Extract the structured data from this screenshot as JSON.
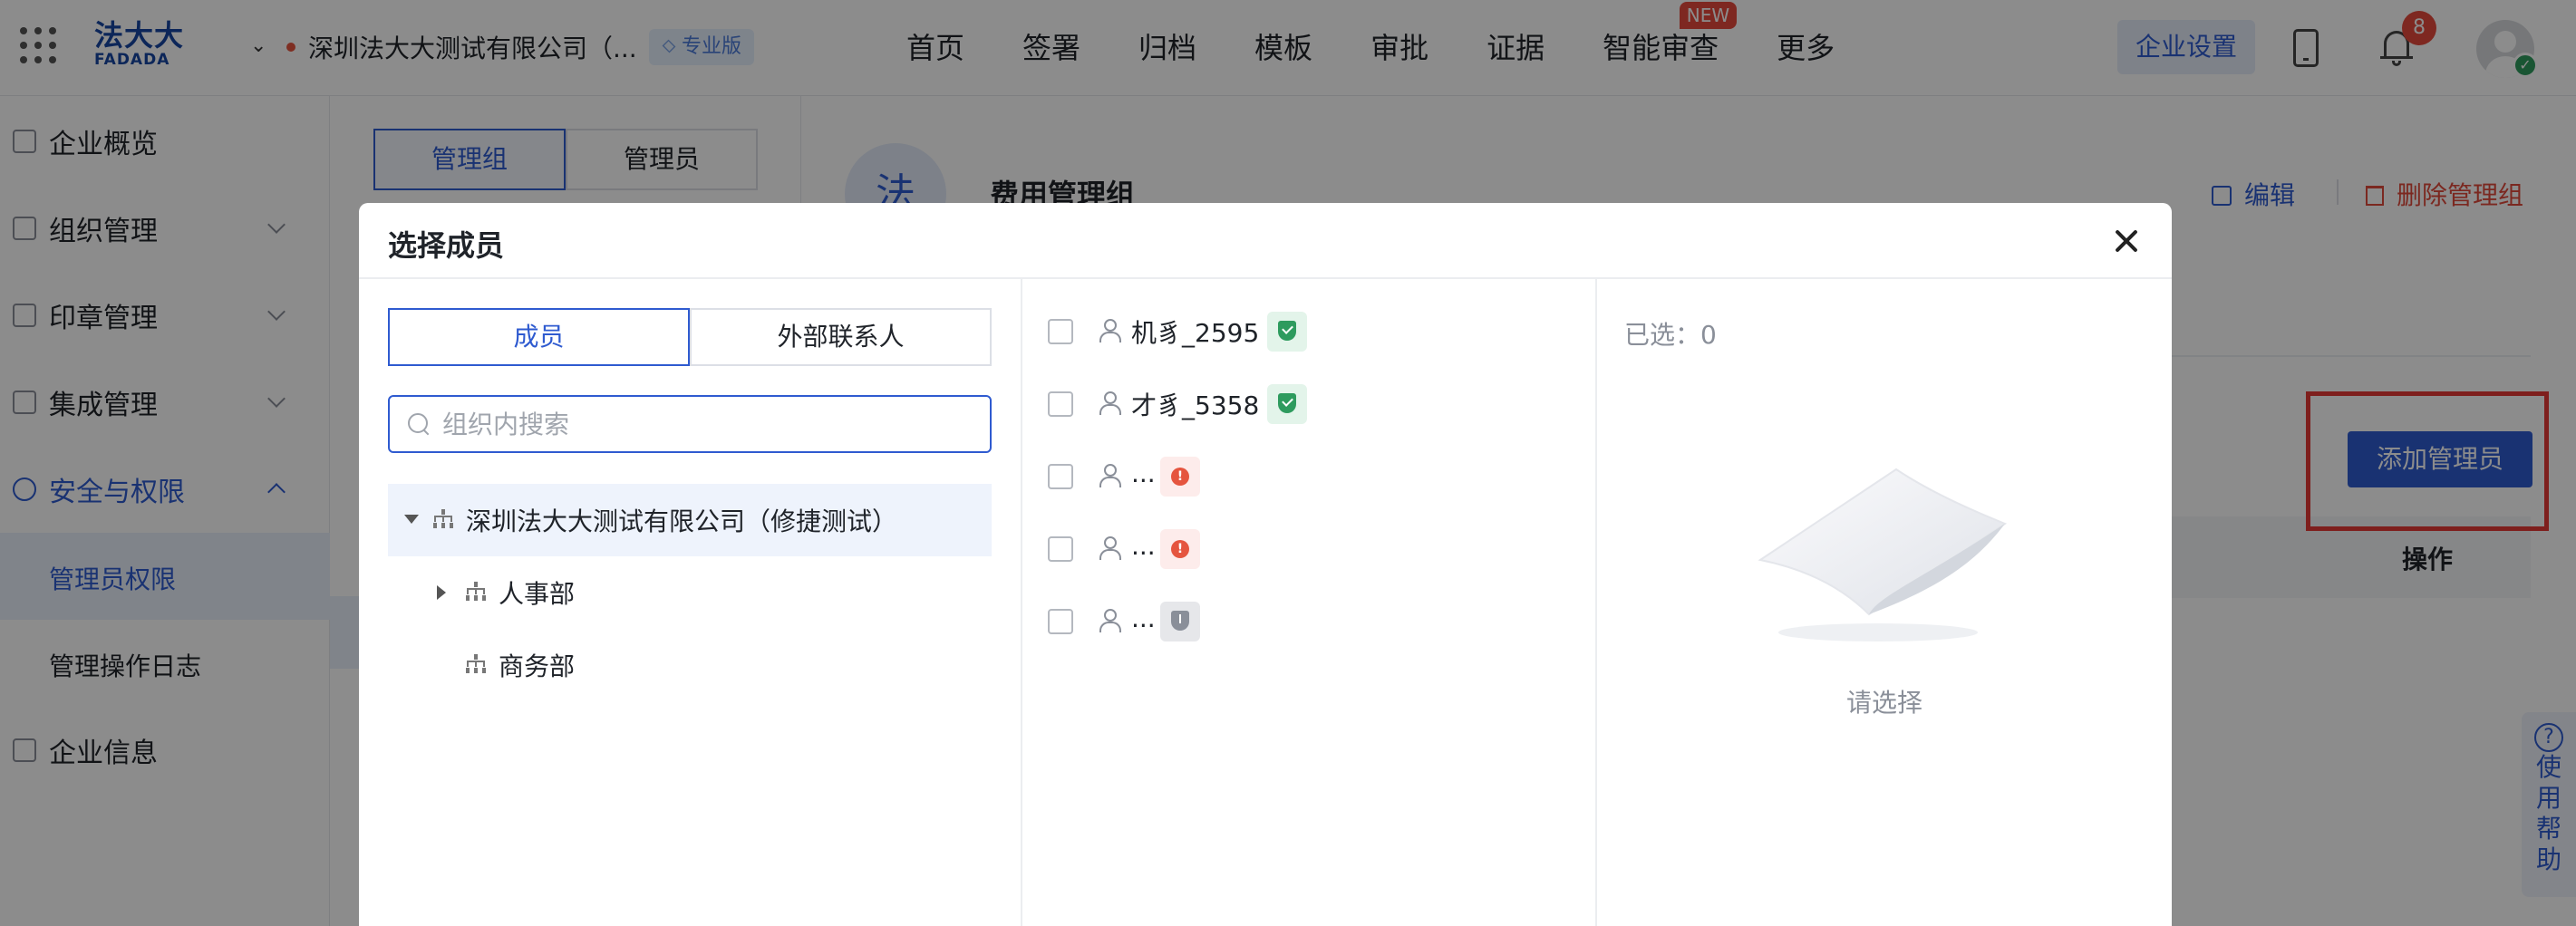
{
  "topbar": {
    "logo_line1": "法大大",
    "logo_line2": "FADADA",
    "company_name": "深圳法大大测试有限公司（...",
    "edition": "专业版",
    "nav": [
      {
        "label": "首页"
      },
      {
        "label": "签署"
      },
      {
        "label": "归档"
      },
      {
        "label": "模板"
      },
      {
        "label": "审批"
      },
      {
        "label": "证据"
      },
      {
        "label": "智能审查",
        "badge": "NEW"
      },
      {
        "label": "更多"
      }
    ],
    "enterprise_settings": "企业设置",
    "notification_count": "8"
  },
  "sidebar": {
    "items": [
      {
        "label": "企业概览"
      },
      {
        "label": "组织管理"
      },
      {
        "label": "印章管理"
      },
      {
        "label": "集成管理"
      },
      {
        "label": "安全与权限"
      },
      {
        "label": "企业信息"
      }
    ],
    "sub_items": [
      {
        "label": "管理员权限"
      },
      {
        "label": "管理操作日志"
      }
    ]
  },
  "admin_panel": {
    "tabs": [
      {
        "label": "管理组"
      },
      {
        "label": "管理员"
      }
    ]
  },
  "main": {
    "group_avatar": "法",
    "group_title": "费用管理组",
    "edit_label": "编辑",
    "delete_label": "删除管理组",
    "add_admin_label": "添加管理员",
    "operation_col": "操作",
    "help_text": [
      "使",
      "用",
      "帮",
      "助"
    ]
  },
  "modal": {
    "title": "选择成员",
    "tabs": [
      {
        "label": "成员"
      },
      {
        "label": "外部联系人"
      }
    ],
    "search_placeholder": "组织内搜索",
    "tree": {
      "root": "深圳法大大测试有限公司（修捷测试）",
      "children": [
        {
          "label": "人事部",
          "expandable": true
        },
        {
          "label": "商务部",
          "expandable": false
        }
      ]
    },
    "members": [
      {
        "name": "机豸_2595",
        "status": "verified"
      },
      {
        "name": "才豸_5358",
        "status": "verified"
      },
      {
        "name": "...",
        "status": "warning"
      },
      {
        "name": "...",
        "status": "warning"
      },
      {
        "name": "...",
        "status": "unverified"
      }
    ],
    "selected_label": "已选：0",
    "empty_text": "请选择"
  },
  "colors": {
    "primary": "#2f5bd0",
    "danger": "#e0493b",
    "verified": "#2e9b5e",
    "warning": "#e5553f",
    "highlight": "#e53935"
  }
}
